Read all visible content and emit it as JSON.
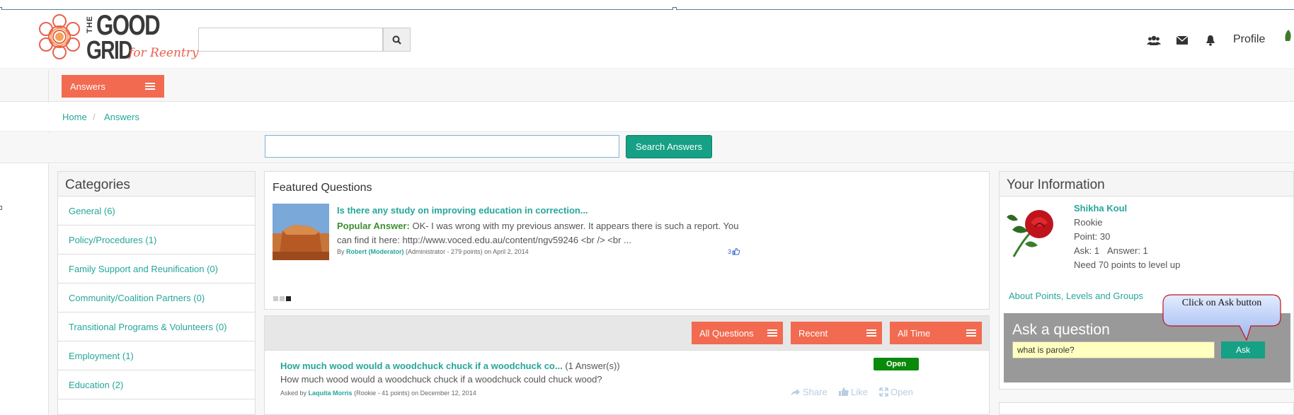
{
  "header": {
    "logo": {
      "line1": "THE",
      "line2": "GOOD",
      "line3": "GRID",
      "tagline": "for Reentry"
    },
    "search": {
      "placeholder": ""
    },
    "icons": [
      "users-icon",
      "envelope-icon",
      "bell-icon",
      "search-icon"
    ],
    "profile_label": "Profile"
  },
  "subnav": {
    "answers_label": "Answers"
  },
  "breadcrumb": {
    "home": "Home",
    "separator": "/",
    "current": "Answers"
  },
  "answers_search": {
    "value": "",
    "button_label": "Search Answers"
  },
  "categories": {
    "title": "Categories",
    "items": [
      "General (6)",
      "Policy/Procedures (1)",
      "Family Support and Reunification (0)",
      "Community/Coalition Partners (0)",
      "Transitional Programs & Volunteers (0)",
      "Employment (1)",
      "Education (2)"
    ]
  },
  "featured": {
    "title": "Featured Questions",
    "question": "Is there any study on improving education in correction...",
    "answer_label": "Popular Answer:",
    "answer_text": "OK- I was wrong with my previous answer. It appears there is such a report. You can find it here: http://www.voced.edu.au/content/ngv59246 <br /> <br ...",
    "by": "By",
    "author": "Robert (Moderator)",
    "author_info": "(Administrator - 279 points)",
    "date": "on April 2, 2014",
    "likes": "3"
  },
  "filters": [
    "All Questions",
    "Recent",
    "All Time"
  ],
  "questions": [
    {
      "title": "How much wood would a woodchuck chuck if a woodchuck co...",
      "answers": "(1 Answer(s))",
      "body": "How much wood would a woodchuck chuck if a woodchuck could chuck wood?",
      "asked_by": "Asked by",
      "author": "Laquita Morris",
      "author_info": "(Rookie - 41 points)",
      "date": "on December 12, 2014",
      "status": "Open",
      "actions": {
        "share": "Share",
        "like": "Like",
        "open": "Open"
      }
    }
  ],
  "info": {
    "title": "Your Information",
    "name": "Shikha Koul",
    "rank": "Rookie",
    "points": "Point: 30",
    "ask": "Ask: 1",
    "answer": "Answer: 1",
    "level": "Need 70 points to level up",
    "link": "About Points, Levels and Groups"
  },
  "ask_box": {
    "title": "Ask a question",
    "input_value": "what is parole?",
    "button_label": "Ask"
  },
  "callout": {
    "text": "Click on Ask button"
  },
  "colors": {
    "accent": "#f26a50",
    "link": "#26a69a",
    "primary_button": "#16a085",
    "status_open": "#0a8a0a"
  }
}
